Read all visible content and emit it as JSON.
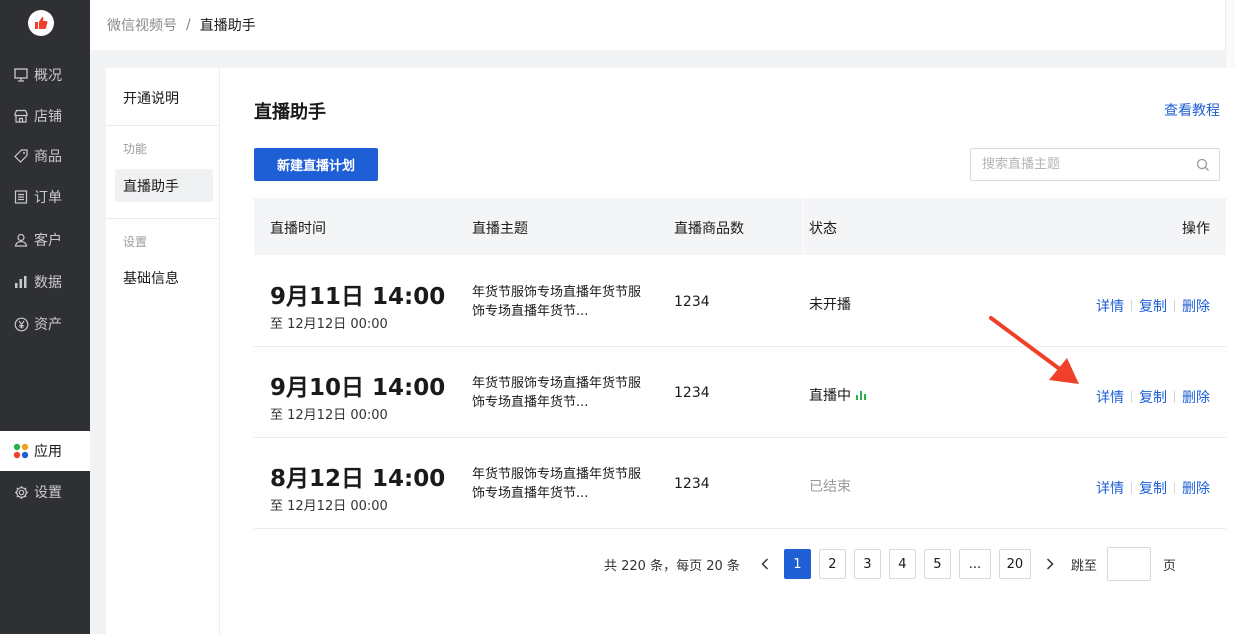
{
  "sidebar": {
    "items": [
      {
        "label": "概况",
        "icon": "overview-icon"
      },
      {
        "label": "店铺",
        "icon": "store-icon"
      },
      {
        "label": "商品",
        "icon": "tag-icon"
      },
      {
        "label": "订单",
        "icon": "order-icon"
      },
      {
        "label": "客户",
        "icon": "user-icon"
      },
      {
        "label": "数据",
        "icon": "bar-chart-icon"
      },
      {
        "label": "资产",
        "icon": "yen-icon"
      }
    ],
    "active_item": {
      "label": "应用",
      "icon": "apps-icon"
    },
    "settings_item": {
      "label": "设置",
      "icon": "gear-icon"
    }
  },
  "breadcrumb": {
    "parent": "微信视频号",
    "separator": "/",
    "current": "直播助手"
  },
  "subnav": {
    "intro": "开通说明",
    "group_function": "功能",
    "active": "直播助手",
    "group_settings": "设置",
    "basic_info": "基础信息"
  },
  "main": {
    "title": "直播助手",
    "tutorial_link": "查看教程",
    "new_button": "新建直播计划",
    "search_placeholder": "搜索直播主题"
  },
  "table": {
    "headers": {
      "time": "直播时间",
      "topic": "直播主题",
      "count": "直播商品数",
      "status": "状态",
      "actions": "操作"
    },
    "rows": [
      {
        "start": "9月11日 14:00",
        "end": "至 12月12日 00:00",
        "topic": "年货节服饰专场直播年货节服饰专场直播年货节...",
        "count": "1234",
        "status": "未开播",
        "status_style": "normal"
      },
      {
        "start": "9月10日 14:00",
        "end": "至 12月12日 00:00",
        "topic": "年货节服饰专场直播年货节服饰专场直播年货节...",
        "count": "1234",
        "status": "直播中",
        "status_style": "live"
      },
      {
        "start": "8月12日 14:00",
        "end": "至 12月12日 00:00",
        "topic": "年货节服饰专场直播年货节服饰专场直播年货节...",
        "count": "1234",
        "status": "已结束",
        "status_style": "muted"
      }
    ],
    "actions": {
      "detail": "详情",
      "copy": "复制",
      "delete": "删除"
    }
  },
  "pagination": {
    "total_text": "共 220 条，每页 20 条",
    "pages": [
      "1",
      "2",
      "3",
      "4",
      "5",
      "...",
      "20"
    ],
    "current": "1",
    "jump_label": "跳至",
    "page_unit": "页"
  },
  "colors": {
    "primary": "#1f5fd6",
    "sidebar_bg": "#2f3033",
    "live_green": "#2bb24c",
    "annotation_red": "#f0402a"
  }
}
